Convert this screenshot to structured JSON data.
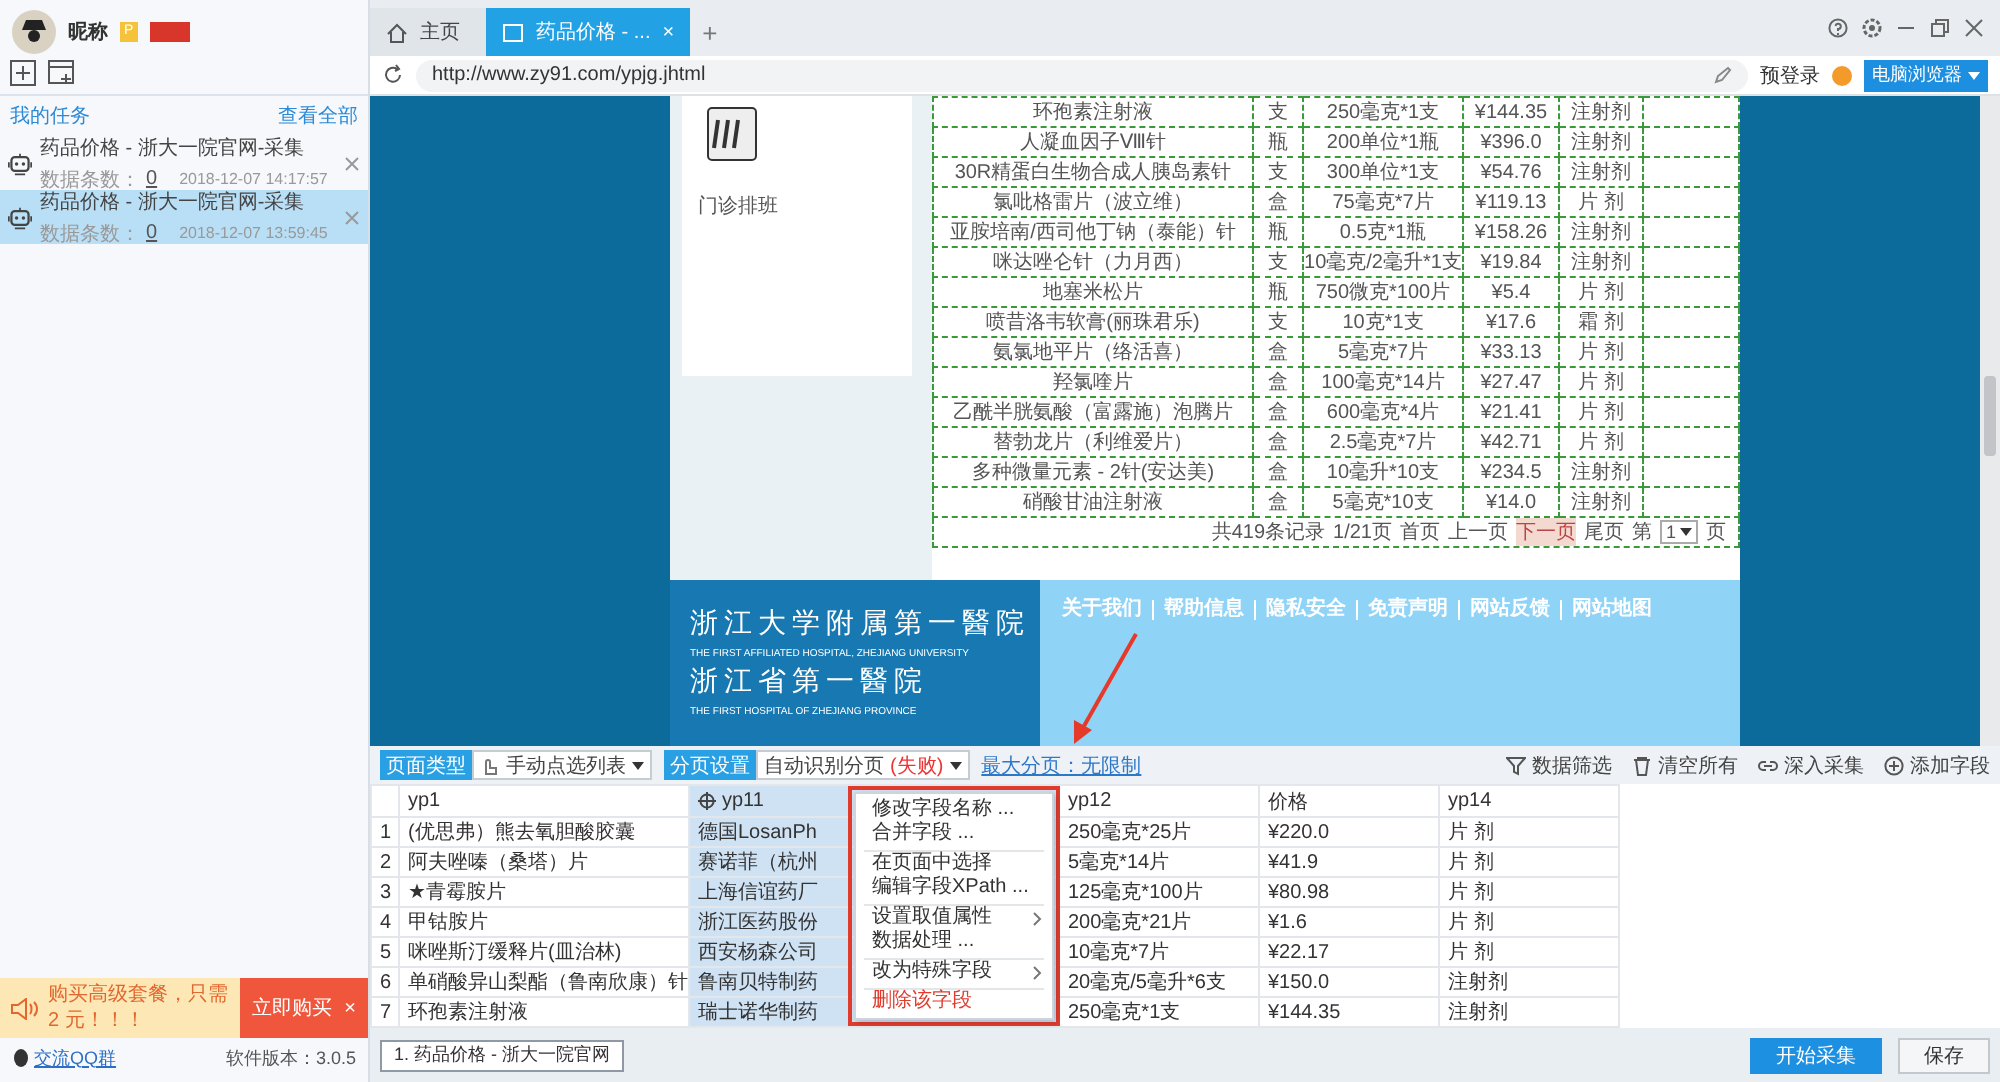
{
  "sidebar": {
    "user": {
      "nickname": "昵称",
      "level_badge": "P"
    },
    "tasks_header": {
      "title": "我的任务",
      "link": "查看全部"
    },
    "tasks": [
      {
        "title": "药品价格 - 浙大一院官网-采集",
        "count_label": "数据条数：",
        "count": "0",
        "time": "2018-12-07 14:17:57",
        "selected": false
      },
      {
        "title": "药品价格 - 浙大一院官网-采集",
        "count_label": "数据条数：",
        "count": "0",
        "time": "2018-12-07 13:59:45",
        "selected": true
      }
    ],
    "promo": {
      "text": "购买高级套餐，只需 2 元！！！",
      "button": "立即购买",
      "close": "×"
    },
    "footer": {
      "qq_link": "交流QQ群",
      "version": "软件版本：3.0.5"
    }
  },
  "browser": {
    "tabs": [
      {
        "kind": "home",
        "label": "主页",
        "selected": false
      },
      {
        "kind": "page",
        "label": "药品价格 - ...",
        "selected": true,
        "close": "×"
      }
    ],
    "new_tab": "+",
    "url": "http://www.zy91.com/ypjg.jhtml",
    "login": "预登录",
    "mode_button": "电脑浏览器"
  },
  "web_page": {
    "schedule_label": "门诊排班",
    "table_rows": [
      [
        "环孢素注射液",
        "支",
        "250毫克*1支",
        "¥144.35",
        "注射剂"
      ],
      [
        "人凝血因子Ⅷ针",
        "瓶",
        "200单位*1瓶",
        "¥396.0",
        "注射剂"
      ],
      [
        "30R精蛋白生物合成人胰岛素针",
        "支",
        "300单位*1支",
        "¥54.76",
        "注射剂"
      ],
      [
        "氯吡格雷片（波立维）",
        "盒",
        "75毫克*7片",
        "¥119.13",
        "片 剂"
      ],
      [
        "亚胺培南/西司他丁钠（泰能）针",
        "瓶",
        "0.5克*1瓶",
        "¥158.26",
        "注射剂"
      ],
      [
        "咪达唑仑针（力月西）",
        "支",
        "10毫克/2毫升*1支",
        "¥19.84",
        "注射剂"
      ],
      [
        "地塞米松片",
        "瓶",
        "750微克*100片",
        "¥5.4",
        "片 剂"
      ],
      [
        "喷昔洛韦软膏(丽珠君乐)",
        "支",
        "10克*1支",
        "¥17.6",
        "霜 剂"
      ],
      [
        "氨氯地平片（络活喜）",
        "盒",
        "5毫克*7片",
        "¥33.13",
        "片 剂"
      ],
      [
        "羟氯喹片",
        "盒",
        "100毫克*14片",
        "¥27.47",
        "片 剂"
      ],
      [
        "乙酰半胱氨酸（富露施）泡腾片",
        "盒",
        "600毫克*4片",
        "¥21.41",
        "片 剂"
      ],
      [
        "替勃龙片（利维爱片）",
        "盒",
        "2.5毫克*7片",
        "¥42.71",
        "片 剂"
      ],
      [
        "多种微量元素 - 2针(安达美)",
        "盒",
        "10毫升*10支",
        "¥234.5",
        "注射剂"
      ],
      [
        "硝酸甘油注射液",
        "盒",
        "5毫克*10支",
        "¥14.0",
        "注射剂"
      ]
    ],
    "pagination": {
      "summary": "共419条记录",
      "pages": "1/21页",
      "links": [
        {
          "label": "首页",
          "highlighted": false
        },
        {
          "label": "上一页",
          "highlighted": false
        },
        {
          "label": "下一页",
          "highlighted": true
        },
        {
          "label": "尾页",
          "highlighted": false
        }
      ],
      "jump_before": "第",
      "jump_value": "1",
      "jump_after": "页"
    },
    "footer": {
      "names": [
        {
          "name": "浙江大学附属第一醫院",
          "english": "THE FIRST AFFILIATED HOSPITAL, ZHEJIANG UNIVERSITY"
        },
        {
          "name": "浙江省第一醫院",
          "english": "THE FIRST HOSPITAL OF ZHEJIANG PROVINCE"
        }
      ],
      "links": [
        "关于我们",
        "帮助信息",
        "隐私安全",
        "免责声明",
        "网站反馈",
        "网站地图"
      ]
    }
  },
  "toolbar": {
    "page_type_label": "页面类型",
    "page_type_value": "手动点选列表",
    "paging_label": "分页设置",
    "paging_value": "自动识别分页",
    "paging_status": "(失败)",
    "max_pages_link": "最大分页：无限制",
    "actions": [
      {
        "kind": "filter",
        "label": "数据筛选"
      },
      {
        "kind": "trash",
        "label": "清空所有"
      },
      {
        "kind": "link",
        "label": "深入采集"
      },
      {
        "kind": "add",
        "label": "添加字段"
      }
    ]
  },
  "grid": {
    "columns": [
      {
        "label": "yp1",
        "selected": false
      },
      {
        "label": "yp11",
        "selected": true
      },
      {
        "label": "yp12",
        "selected": false
      },
      {
        "label": "价格",
        "selected": false
      },
      {
        "label": "yp14",
        "selected": false
      }
    ],
    "rows": [
      {
        "num": "1",
        "cells": [
          "(优思弗）熊去氧胆酸胶囊",
          "德国LosanPh",
          "250毫克*25片",
          "¥220.0",
          "片 剂"
        ]
      },
      {
        "num": "2",
        "cells": [
          "阿夫唑嗪（桑塔）片",
          "赛诺菲（杭州",
          "5毫克*14片",
          "¥41.9",
          "片 剂"
        ]
      },
      {
        "num": "3",
        "cells": [
          "★青霉胺片",
          "上海信谊药厂",
          "125毫克*100片",
          "¥80.98",
          "片 剂"
        ]
      },
      {
        "num": "4",
        "cells": [
          "甲钴胺片",
          "浙江医药股份",
          "200毫克*21片",
          "¥1.6",
          "片 剂"
        ]
      },
      {
        "num": "5",
        "cells": [
          "咪唑斯汀缓释片(皿治林)",
          "西安杨森公司",
          "10毫克*7片",
          "¥22.17",
          "片 剂"
        ]
      },
      {
        "num": "6",
        "cells": [
          "单硝酸异山梨酯（鲁南欣康）针",
          "鲁南贝特制药",
          "20毫克/5毫升*6支",
          "¥150.0",
          "注射剂"
        ]
      },
      {
        "num": "7",
        "cells": [
          "环孢素注射液",
          "瑞士诺华制药",
          "250毫克*1支",
          "¥144.35",
          "注射剂"
        ]
      }
    ]
  },
  "context_menu": {
    "items": [
      {
        "label": "修改字段名称 ...",
        "kind": "normal",
        "submenu": false,
        "separator_after": false
      },
      {
        "label": "合并字段 ...",
        "kind": "normal",
        "submenu": false,
        "separator_after": true
      },
      {
        "label": "在页面中选择",
        "kind": "normal",
        "submenu": false,
        "separator_after": false
      },
      {
        "label": "编辑字段XPath ...",
        "kind": "normal",
        "submenu": false,
        "separator_after": true
      },
      {
        "label": "设置取值属性",
        "kind": "normal",
        "submenu": true,
        "separator_after": false
      },
      {
        "label": "数据处理 ...",
        "kind": "normal",
        "submenu": false,
        "separator_after": true
      },
      {
        "label": "改为特殊字段",
        "kind": "normal",
        "submenu": true,
        "separator_after": true
      },
      {
        "label": "删除该字段",
        "kind": "danger",
        "submenu": false,
        "separator_after": false
      }
    ]
  },
  "task_tabs": [
    {
      "label": "1. 药品价格 - 浙大一院官网",
      "selected": true
    }
  ],
  "buttons": [
    {
      "label": "开始采集",
      "kind": "primary"
    },
    {
      "label": "保存",
      "kind": "default"
    }
  ]
}
